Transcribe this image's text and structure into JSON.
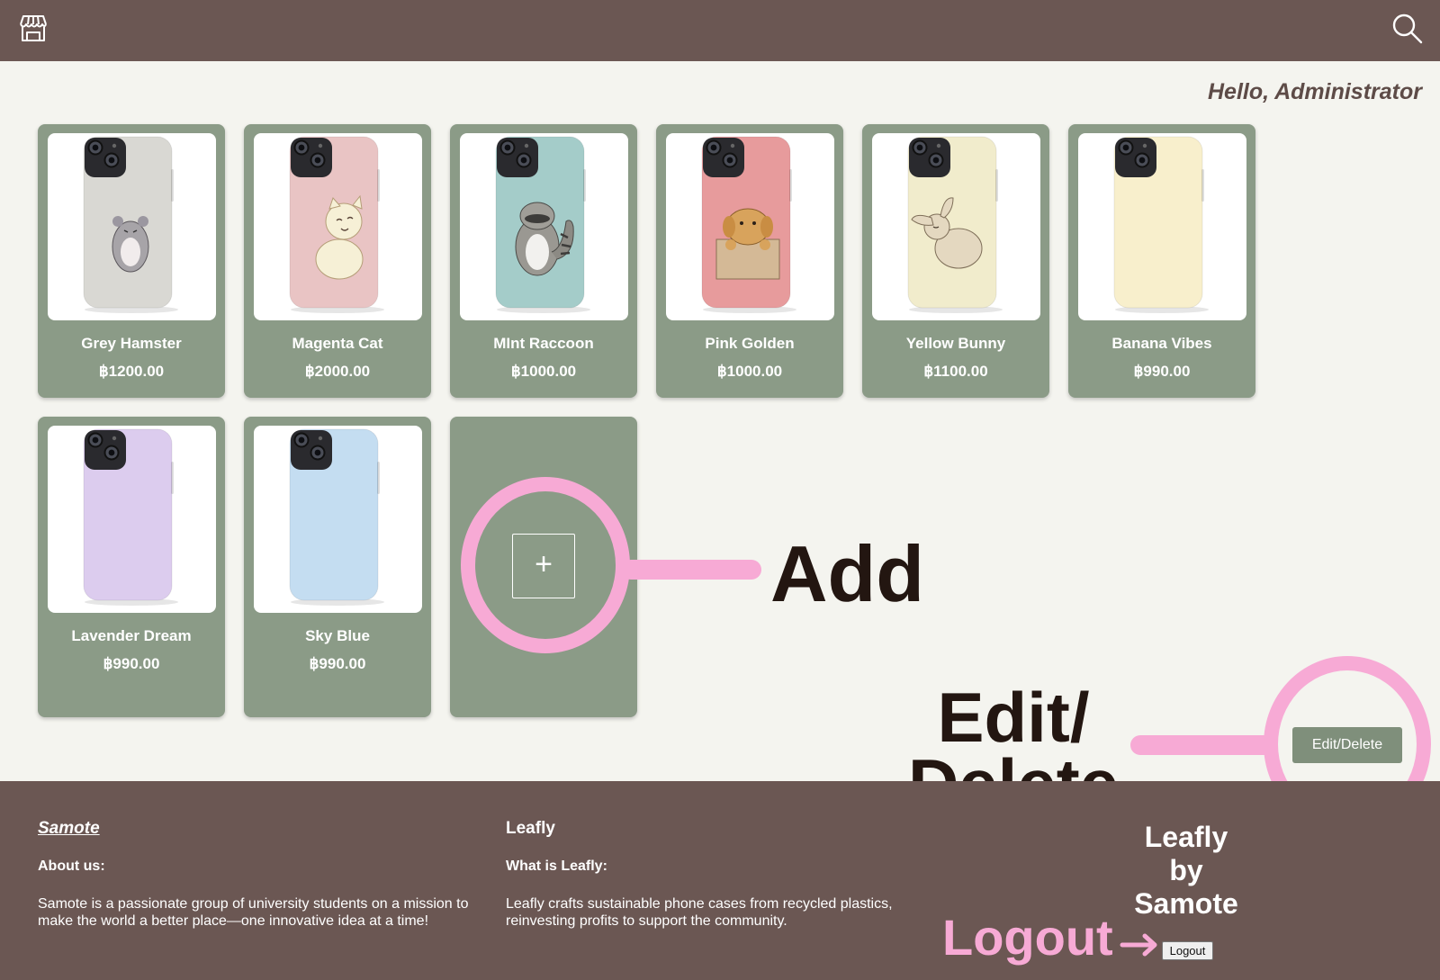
{
  "header": {
    "store_icon": "storefront-icon",
    "search_icon": "search-icon",
    "greeting": "Hello, Administrator"
  },
  "products": [
    {
      "name": "Grey Hamster",
      "price": "฿1200.00",
      "case_color": "#d9d8d3",
      "art": "hamster"
    },
    {
      "name": "Magenta Cat",
      "price": "฿2000.00",
      "case_color": "#e9c4c4",
      "art": "cat"
    },
    {
      "name": "MInt Raccoon",
      "price": "฿1000.00",
      "case_color": "#a4ccc9",
      "art": "raccoon"
    },
    {
      "name": "Pink Golden",
      "price": "฿1000.00",
      "case_color": "#e79b9c",
      "art": "golden"
    },
    {
      "name": "Yellow Bunny",
      "price": "฿1100.00",
      "case_color": "#f1eccc",
      "art": "bunny"
    },
    {
      "name": "Banana Vibes",
      "price": "฿990.00",
      "case_color": "#f8efcc",
      "art": "none"
    },
    {
      "name": "Lavender Dream",
      "price": "฿990.00",
      "case_color": "#dcccee",
      "art": "none"
    },
    {
      "name": "Sky Blue",
      "price": "฿990.00",
      "case_color": "#c4ddf1",
      "art": "none"
    }
  ],
  "add_card": {
    "label": "+"
  },
  "annotations": {
    "add": "Add",
    "edit_delete": "Edit/\nDelete",
    "logout": "Logout",
    "ring_color": "#f7aad5"
  },
  "edit_button": "Edit/Delete",
  "footer": {
    "brand": "Samote",
    "about_heading": "About us:",
    "about_text": "Samote is a passionate group of university students on a mission to make the world a better place—one innovative idea at a time!",
    "leafly_title": "Leafly",
    "what_heading": "What is Leafly:",
    "what_text": "Leafly crafts sustainable phone cases from recycled plastics, reinvesting profits to support the community.",
    "by_line": "Leafly\nby\nSamote",
    "logout_button": "Logout"
  },
  "colors": {
    "header_bg": "#6b5753",
    "card_bg": "#8b9b87",
    "page_bg": "#f4f4ef",
    "accent_pink": "#f7aad5"
  }
}
